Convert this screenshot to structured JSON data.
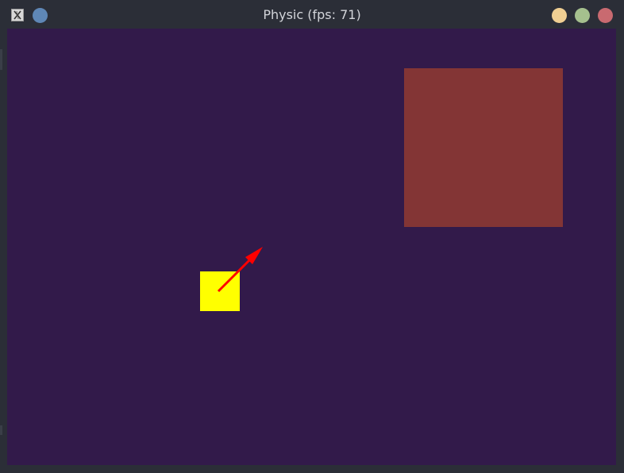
{
  "window": {
    "title": "Physic (fps: 71)",
    "pin_color": "#5f87b6",
    "controls": {
      "minimize_color": "#f0cf93",
      "maximize_color": "#a5c08e",
      "close_color": "#c96a70"
    }
  },
  "scene": {
    "background_color": "#321a4a",
    "obstacle": {
      "color": "#833535"
    },
    "player": {
      "color": "#ffff00"
    },
    "velocity_arrow": {
      "color": "#ff0000"
    }
  }
}
